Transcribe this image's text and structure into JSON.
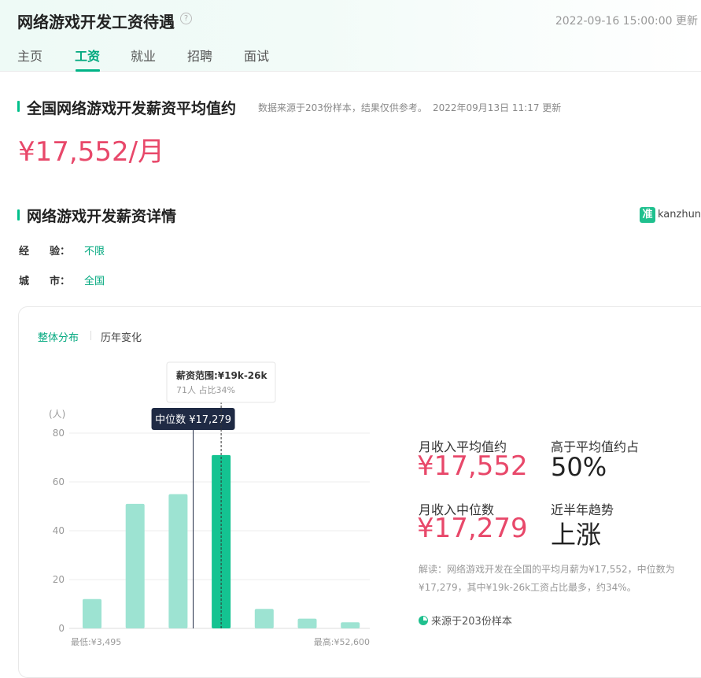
{
  "header": {
    "title": "网络游戏开发工资待遇",
    "help_icon": "?",
    "timestamp": "2022-09-16 15:00:00 更新",
    "tabs": [
      "主页",
      "工资",
      "就业",
      "招聘",
      "面试"
    ],
    "active_tab": "工资"
  },
  "avg_section": {
    "title": "全国网络游戏开发薪资平均值约",
    "note": "数据来源于203份样本，结果仅供参考。",
    "updated": "2022年09月13日 11:17 更新",
    "big_value": "¥17,552/月"
  },
  "detail_section": {
    "title": "网络游戏开发薪资详情",
    "brand_logo": "准",
    "brand_text": "kanzhun",
    "filters": [
      {
        "label": "经　　验：",
        "value": "不限"
      },
      {
        "label": "城　　市：",
        "value": "全国"
      }
    ]
  },
  "card": {
    "tabs": [
      "整体分布",
      "历年变化"
    ],
    "tooltip": {
      "title": "薪资范围:¥19k-26k",
      "detail": "71人  占比34%"
    },
    "median_badge": "中位数 ¥17,279",
    "stats": {
      "avg_label": "月收入平均值约",
      "avg_value": "¥17,552",
      "above_label": "高于平均值约占",
      "above_value": "50%",
      "median_label": "月收入中位数",
      "median_value": "¥17,279",
      "trend_label": "近半年趋势",
      "trend_value": "上涨"
    },
    "explain": "解读：网络游戏开发在全国的平均月薪为¥17,552，中位数为¥17,279，其中¥19k-26k工资占比最多，约34%。",
    "source": "来源于203份样本"
  },
  "chart_data": {
    "type": "bar",
    "unit": "(人)",
    "ylim": [
      0,
      80
    ],
    "yticks": [
      0,
      20,
      40,
      60,
      80
    ],
    "values": [
      12,
      51,
      55,
      71,
      8,
      4,
      2.5
    ],
    "highlight_index": 3,
    "median_position": 2.35,
    "min_label": "最低:¥3,495",
    "max_label": "最高:¥52,600",
    "colors": {
      "bar": "#9de3d2",
      "highlight": "#14c391",
      "grid": "#eeeeee"
    }
  }
}
